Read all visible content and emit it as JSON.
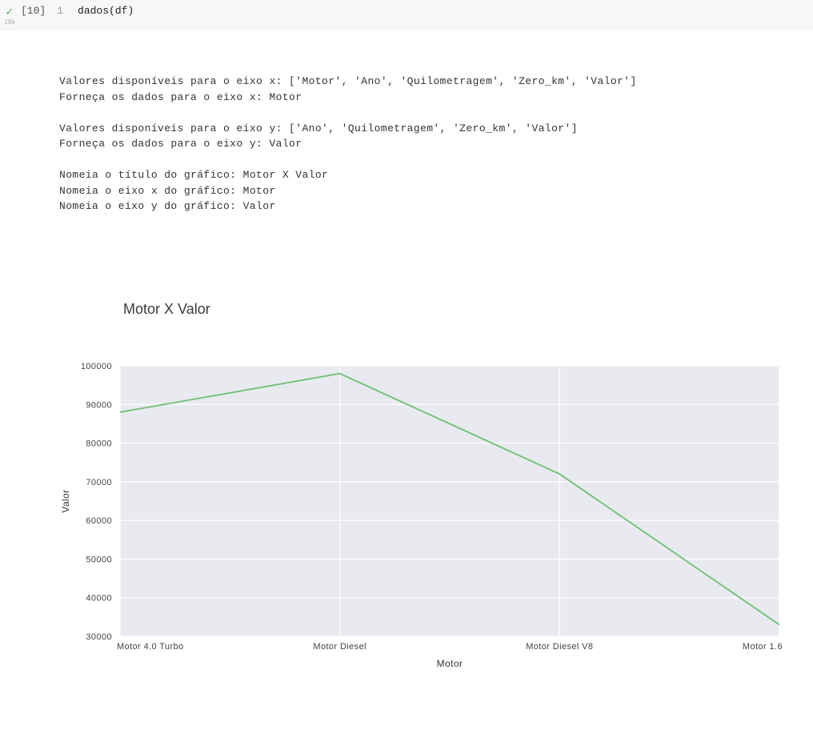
{
  "cell": {
    "status_icon": "✓",
    "exec_time": "19s",
    "exec_count": "[10]",
    "line_number": "1",
    "code": "dados(df)"
  },
  "output_lines": [
    "Valores disponíveis para o eixo x: ['Motor', 'Ano', 'Quilometragem', 'Zero_km', 'Valor']",
    "Forneça os dados para o eixo x: Motor",
    "",
    "Valores disponíveis para o eixo y: ['Ano', 'Quilometragem', 'Zero_km', 'Valor']",
    "Forneça os dados para o eixo y: Valor",
    "",
    "Nomeia o título do gráfico: Motor X Valor",
    "Nomeia o eixo x do gráfico: Motor",
    "Nomeia o eixo y do gráfico: Valor"
  ],
  "chart_data": {
    "type": "line",
    "title": "Motor X Valor",
    "xlabel": "Motor",
    "ylabel": "Valor",
    "categories": [
      "Motor 4.0 Turbo",
      "Motor Diesel",
      "Motor Diesel V8",
      "Motor 1.6"
    ],
    "values": [
      88000,
      98000,
      72000,
      33000
    ],
    "ylim": [
      30000,
      100000
    ],
    "yticks": [
      30000,
      40000,
      50000,
      60000,
      70000,
      80000,
      90000,
      100000
    ]
  }
}
